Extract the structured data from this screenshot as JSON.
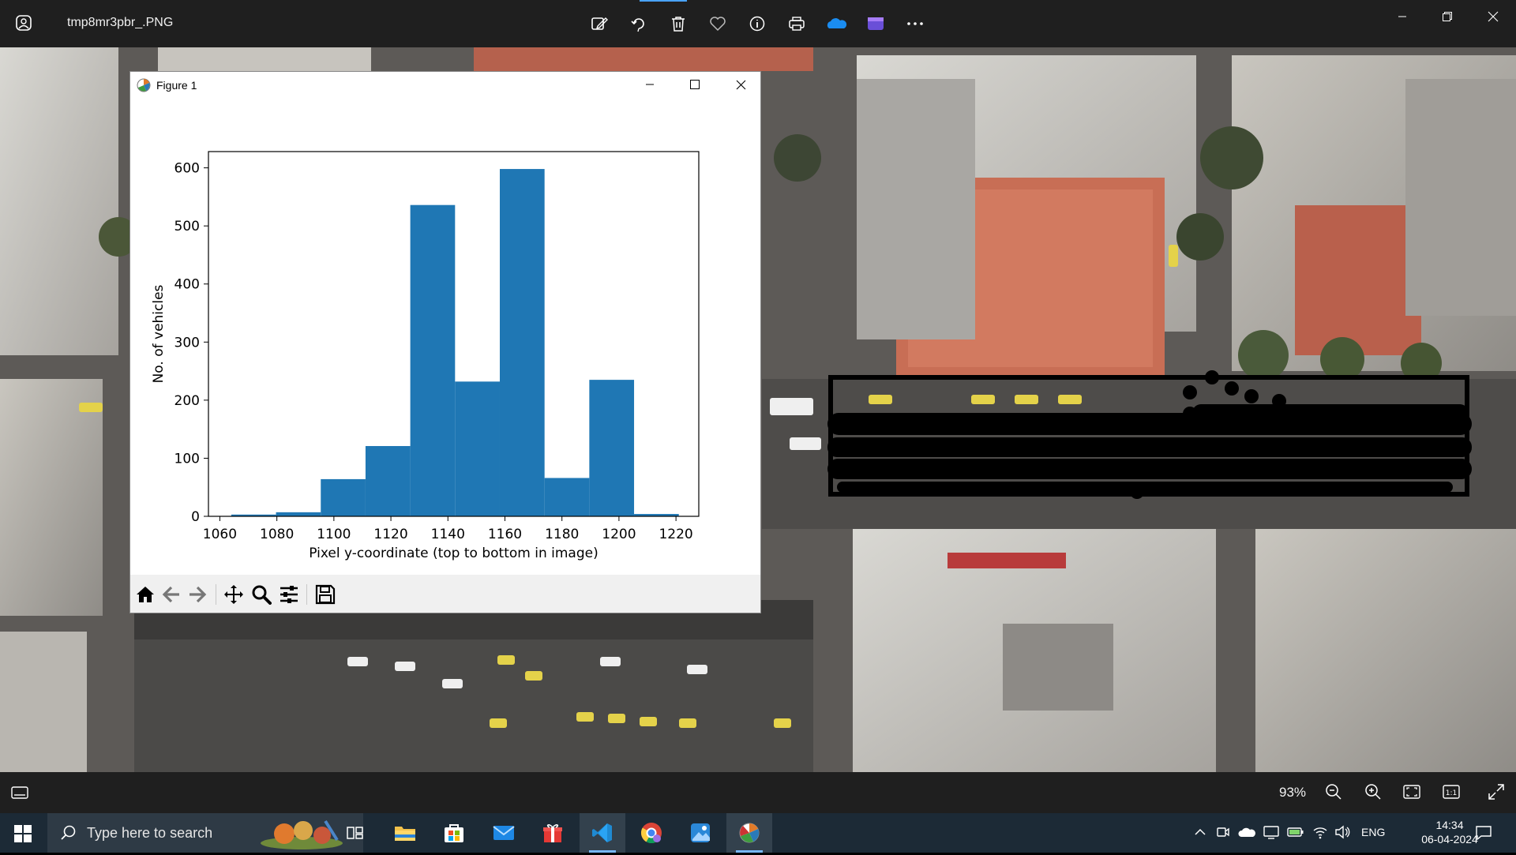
{
  "app": {
    "file_name": "tmp8mr3pbr_.PNG",
    "toolbar_icons": [
      "edit-image-icon",
      "rotate-icon",
      "delete-icon",
      "favorite-icon",
      "info-icon",
      "print-icon",
      "onedrive-icon",
      "clipchamp-icon",
      "more-icon"
    ],
    "window_controls": [
      "minimize-icon",
      "restore-icon",
      "close-icon"
    ]
  },
  "bottom_bar": {
    "zoom_level": "93%",
    "icons": [
      "filmstrip-icon",
      "zoom-out-icon",
      "zoom-in-icon",
      "fit-to-window-icon",
      "actual-size-icon",
      "fullscreen-icon"
    ]
  },
  "figure_window": {
    "title": "Figure 1",
    "toolbar_icons": [
      "home-icon",
      "back-icon",
      "forward-icon",
      "pan-icon",
      "zoom-icon",
      "configure-subplots-icon",
      "save-icon"
    ]
  },
  "chart_data": {
    "type": "bar",
    "histogram": true,
    "bin_edges": [
      1064,
      1079.7,
      1095.4,
      1111.1,
      1126.8,
      1142.5,
      1158.2,
      1173.9,
      1189.6,
      1205.3,
      1221
    ],
    "values": [
      3,
      7,
      64,
      121,
      536,
      232,
      598,
      66,
      235,
      4
    ],
    "color": "#1f77b4",
    "xlabel": "Pixel y-coordinate (top to bottom in image)",
    "ylabel": "No. of vehicles",
    "xlim": [
      1056,
      1228
    ],
    "ylim": [
      0,
      628
    ],
    "xticks": [
      1060,
      1080,
      1100,
      1120,
      1140,
      1160,
      1180,
      1200,
      1220
    ],
    "yticks": [
      0,
      100,
      200,
      300,
      400,
      500,
      600
    ]
  },
  "taskbar": {
    "search_placeholder": "Type here to search",
    "apps": [
      "task-view-icon",
      "file-explorer-icon",
      "microsoft-store-icon",
      "mail-icon",
      "gift-icon",
      "vscode-icon",
      "chrome-icon",
      "photos-app-icon",
      "matplotlib-icon"
    ],
    "tray": [
      "show-hidden-icons-icon",
      "meet-icon",
      "onedrive-tray-icon",
      "monitor-icon",
      "battery-icon",
      "wifi-icon",
      "volume-icon"
    ],
    "language": "ENG",
    "time": "14:34",
    "date": "06-04-2024"
  }
}
